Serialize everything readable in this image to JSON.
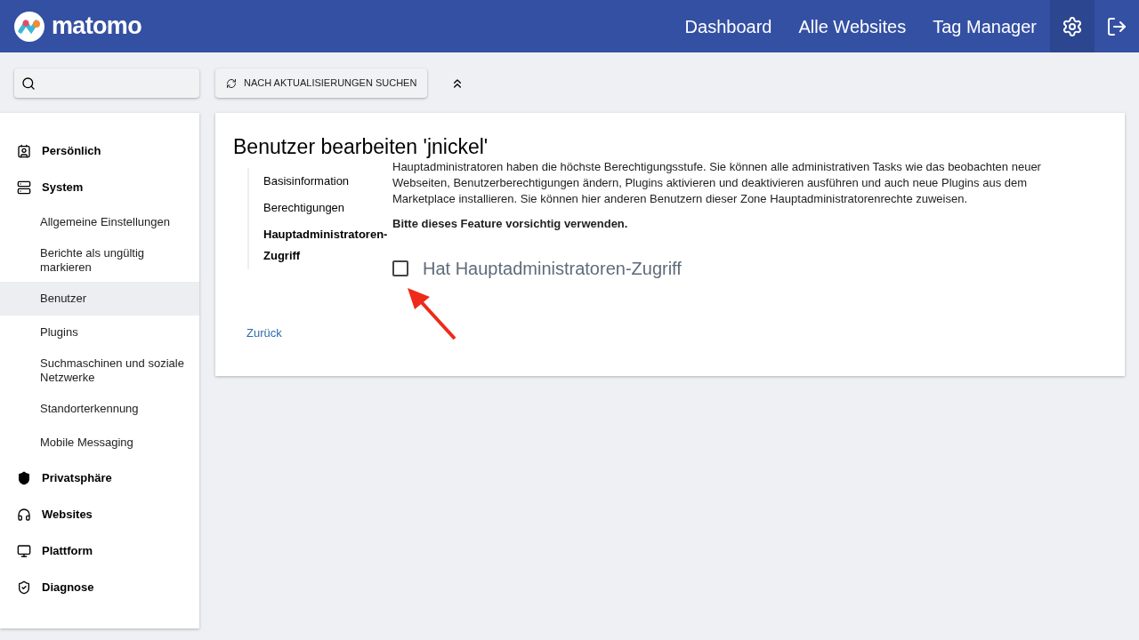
{
  "header": {
    "logo_text": "matomo",
    "nav": [
      {
        "label": "Dashboard"
      },
      {
        "label": "Alle Websites"
      },
      {
        "label": "Tag Manager"
      }
    ],
    "icons": [
      {
        "kind": "settings",
        "selected": true
      },
      {
        "kind": "logout",
        "selected": false
      }
    ]
  },
  "toolbar": {
    "update_button": "NACH AKTUALISIERUNGEN SUCHEN"
  },
  "sidebar": {
    "sections": [
      {
        "kind": "person",
        "label": "Persönlich"
      },
      {
        "kind": "server",
        "label": "System",
        "children": [
          {
            "label": "Allgemeine Einstellungen",
            "selected": false
          },
          {
            "label": "Berichte als ungültig markieren",
            "selected": false
          },
          {
            "label": "Benutzer",
            "selected": true
          },
          {
            "label": "Plugins",
            "selected": false
          },
          {
            "label": "Suchmaschinen und soziale Netzwerke",
            "selected": false
          },
          {
            "label": "Standorterkennung",
            "selected": false
          },
          {
            "label": "Mobile Messaging",
            "selected": false
          }
        ]
      },
      {
        "kind": "privacy",
        "label": "Privatsphäre"
      },
      {
        "kind": "websites",
        "label": "Websites"
      },
      {
        "kind": "platform",
        "label": "Plattform"
      },
      {
        "kind": "diagnose",
        "label": "Diagnose"
      }
    ]
  },
  "card": {
    "title": "Benutzer bearbeiten 'jnickel'",
    "subnav": [
      {
        "label": "Basisinformation",
        "selected": false
      },
      {
        "label": "Berechtigungen",
        "selected": false
      },
      {
        "label": "Hauptadministratoren-Zugriff",
        "selected": true
      }
    ],
    "description": "Hauptadministratoren haben die höchste Berechtigungsstufe. Sie können alle administrativen Tasks wie das beobachten neuer Webseiten, Benutzerberechtigungen ändern, Plugins aktivieren und deaktivieren ausführen und auch neue Plugins aus dem Marketplace installieren. Sie können hier anderen Benutzern dieser Zone Hauptadministratorenrechte zuweisen.",
    "warning": "Bitte dieses Feature vorsichtig verwenden.",
    "checkbox": {
      "label": "Hat Hauptadministratoren-Zugriff",
      "checked": false
    },
    "back_link": "Zurück"
  }
}
